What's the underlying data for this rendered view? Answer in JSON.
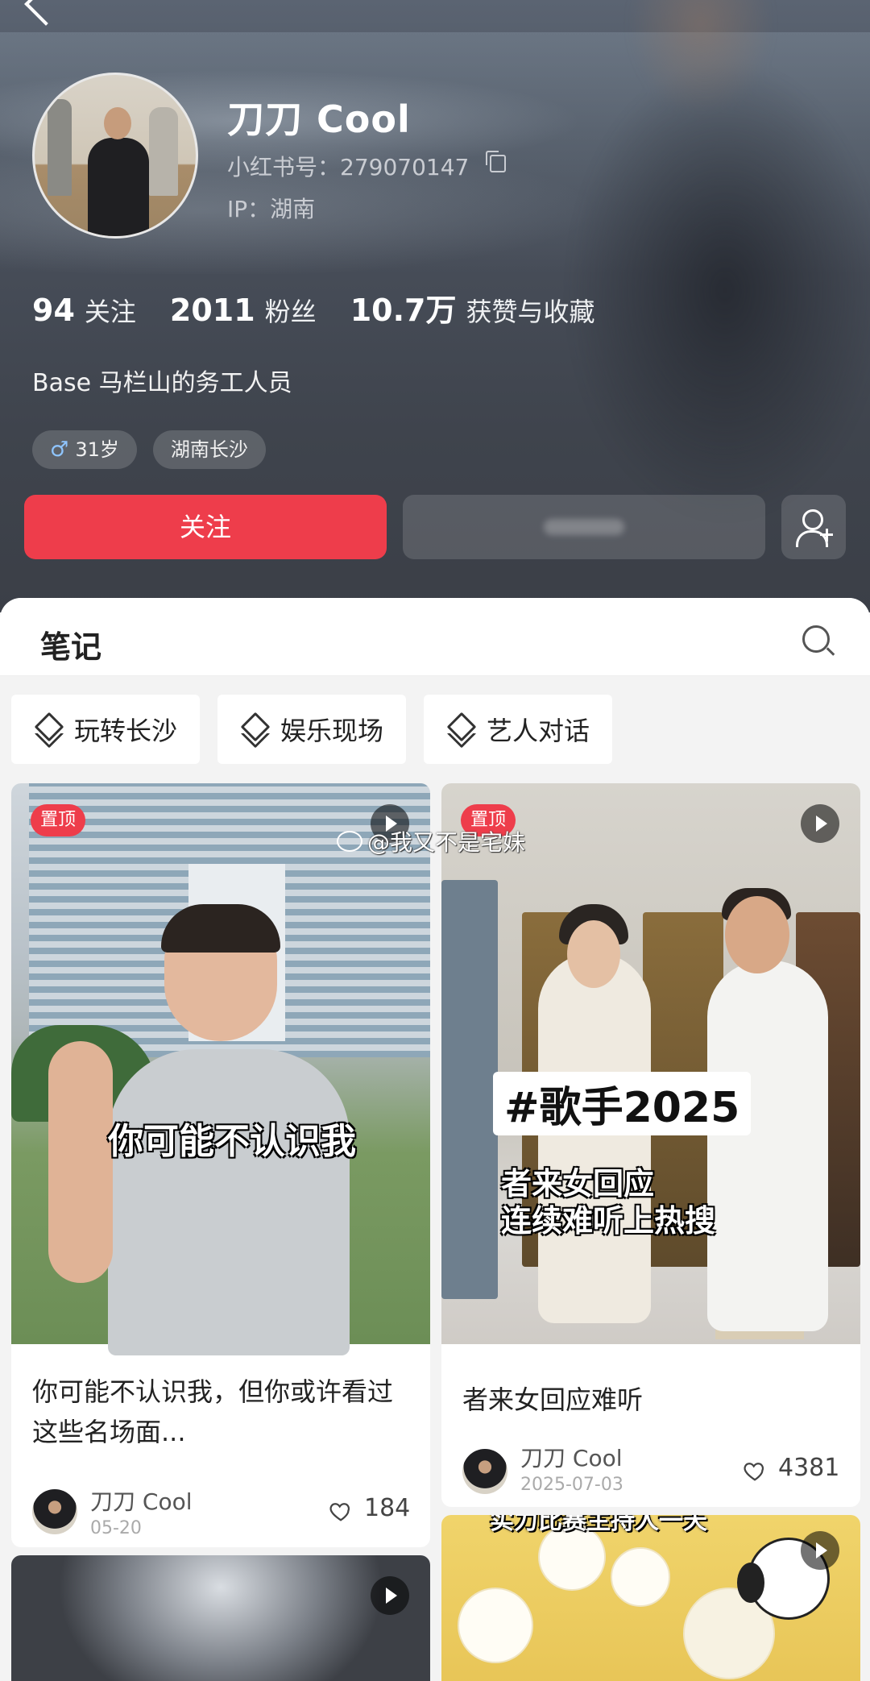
{
  "profile": {
    "name": "刀刀 Cool",
    "red_id": "小红书号：279070147",
    "ip": "IP：湖南",
    "stats": [
      {
        "num": "94",
        "label": "关注"
      },
      {
        "num": "2011",
        "label": "粉丝"
      },
      {
        "num": "10.7万",
        "label": "获赞与收藏"
      }
    ],
    "bio": "Base 马栏山的务工人员",
    "tags": {
      "age": "31岁",
      "location": "湖南长沙",
      "gender_symbol": "♂"
    },
    "follow_label": "关注"
  },
  "notes": {
    "title": "笔记",
    "collections": [
      "玩转长沙",
      "娱乐现场",
      "艺人对话"
    ]
  },
  "watermark": "@我又不是宅妹",
  "cards": [
    {
      "badge": "置顶",
      "overlay": "你可能不认识我",
      "title": "你可能不认识我，但你或许看过这些名场面...",
      "author": "刀刀 Cool",
      "date": "05-20",
      "likes": "184"
    },
    {
      "badge": "置顶",
      "overlay_hashtag": "#歌手2025",
      "overlay_line1": "者来女回应",
      "overlay_line2": "连续难听上热搜",
      "title": "者来女回应难听",
      "author": "刀刀 Cool",
      "date": "2025-07-03",
      "likes": "4381"
    },
    {
      "overlay_top": "实力比赛主持人一天"
    }
  ],
  "colors": {
    "accent": "#ee3d4b",
    "header_bg": "#464c57",
    "page_bg": "#f3f3f3"
  }
}
